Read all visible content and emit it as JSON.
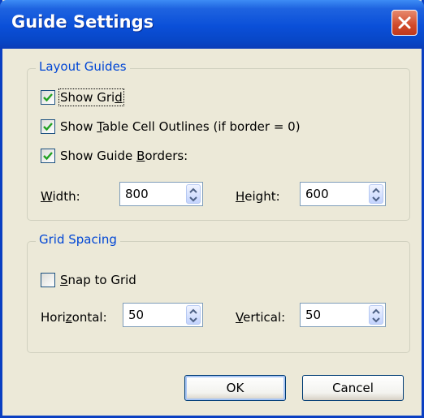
{
  "dialog": {
    "title": "Guide Settings",
    "close_icon": "close-icon"
  },
  "layout_guides": {
    "title": "Layout Guides",
    "show_grid": {
      "pre": "Show Gri",
      "accel": "d",
      "post": "",
      "checked": true
    },
    "show_table_outlines": {
      "pre": "Show ",
      "accel": "T",
      "post": "able Cell Outlines (if border = 0)",
      "checked": true
    },
    "show_guide_borders": {
      "pre": "Show Guide ",
      "accel": "B",
      "post": "orders:",
      "checked": true
    },
    "width": {
      "accel": "W",
      "rest": "idth:",
      "value": "800"
    },
    "height": {
      "accel": "H",
      "rest": "eight:",
      "value": "600"
    }
  },
  "grid_spacing": {
    "title": "Grid Spacing",
    "snap_to_grid": {
      "accel": "S",
      "rest": "nap to Grid",
      "checked": false
    },
    "horizontal": {
      "pre": "Hori",
      "accel": "z",
      "post": "ontal:",
      "value": "50"
    },
    "vertical": {
      "accel": "V",
      "rest": "ertical:",
      "value": "50"
    }
  },
  "buttons": {
    "ok": "OK",
    "cancel": "Cancel"
  },
  "colors": {
    "title_bar": "#0a4fd8",
    "dialog_bg": "#ece9d8",
    "group_title": "#0046d5",
    "close_button": "#d04a2b"
  }
}
